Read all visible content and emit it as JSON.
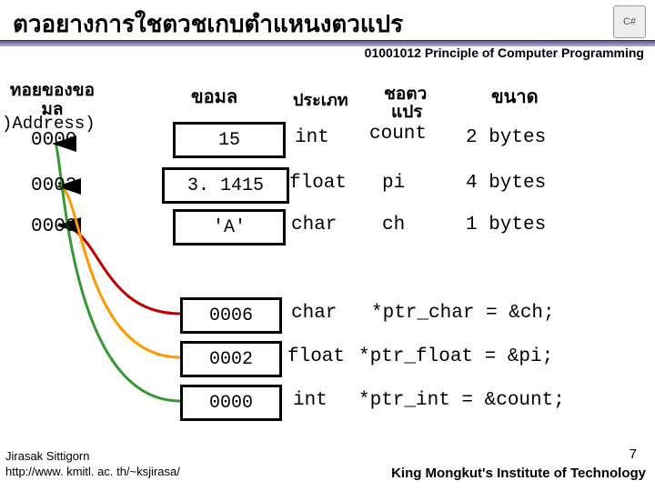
{
  "title": "ตวอยางการใชตวชเกบตำแหนงตวแปร",
  "course": "01001012 Principle of Computer Programming",
  "badge": "C#",
  "headers": {
    "addr_line1": "ทอยของขอ",
    "addr_line2": "มล",
    "addr_sub": ")Address)",
    "data": "ขอมล",
    "type": "ประเภท",
    "var_line1": "ชอตว",
    "var_line2": "แปร",
    "size": "ขนาด"
  },
  "rows": [
    {
      "addr": "0000",
      "data": "15",
      "type": "int",
      "var": "count",
      "size": "2 bytes"
    },
    {
      "addr": "0002",
      "data": "3. 1415",
      "type": "float",
      "var": "pi",
      "size": "4 bytes"
    },
    {
      "addr": "0006",
      "data": "'A'",
      "type": "char",
      "var": "ch",
      "size": "1 bytes"
    }
  ],
  "ptr_rows": [
    {
      "data": "0006",
      "type": "char",
      "expr": "*ptr_char = &ch;"
    },
    {
      "data": "0002",
      "type": "float",
      "expr": "*ptr_float = &pi;"
    },
    {
      "data": "0000",
      "type": "int",
      "expr": "*ptr_int = &count;"
    }
  ],
  "footer": {
    "author": "Jirasak Sittigorn",
    "url": "http://www. kmitl. ac. th/~ksjirasa/",
    "institute": "King Mongkut's Institute of Technology",
    "page": "7"
  }
}
